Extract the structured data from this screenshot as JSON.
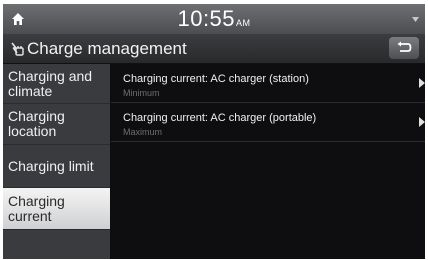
{
  "status": {
    "time": "10:55",
    "ampm": "AM"
  },
  "header": {
    "title": "Charge management"
  },
  "menu": {
    "items": [
      {
        "line1": "Charging and",
        "line2": "climate"
      },
      {
        "line1": "Charging",
        "line2": "location"
      },
      {
        "line1": "Charging limit",
        "line2": ""
      },
      {
        "line1": "Charging",
        "line2": "current"
      }
    ]
  },
  "settings": [
    {
      "title": "Charging current: AC charger (station)",
      "value": "Minimum"
    },
    {
      "title": "Charging current: AC charger (portable)",
      "value": "Maximum"
    }
  ],
  "colors": {
    "active_menu_bg": "#e8e8ea",
    "screen_bg": "#0e0e10"
  },
  "icons": [
    "home-icon",
    "ev-charge-icon",
    "back-arrow-icon",
    "chevron-right-icon",
    "signal-icon"
  ]
}
